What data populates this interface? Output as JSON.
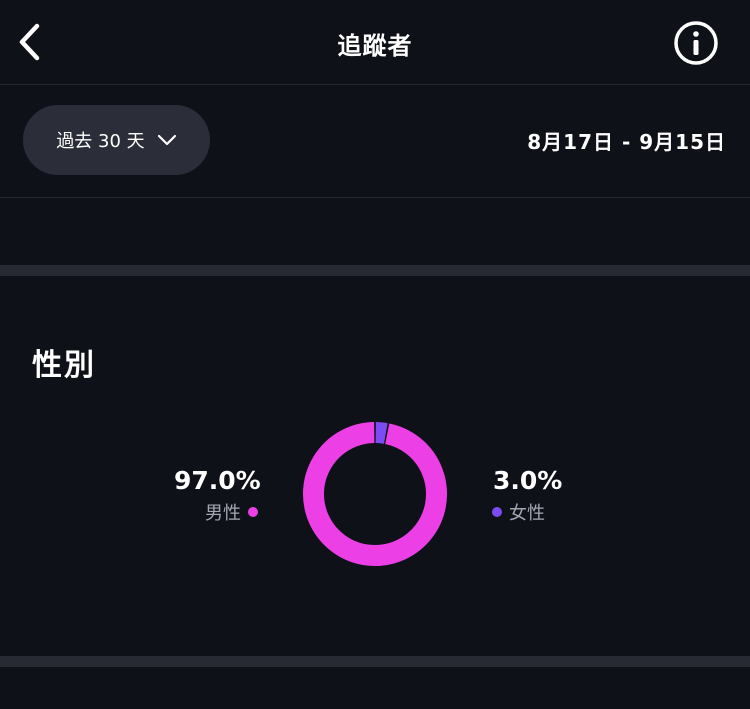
{
  "header": {
    "title": "追蹤者",
    "back_icon": "chevron-left-icon",
    "info_icon": "info-circle-icon"
  },
  "filter": {
    "period_label": "過去 30 天",
    "dropdown_icon": "chevron-down-icon",
    "date_range": "8月17日 - 9月15日"
  },
  "gender": {
    "title": "性別",
    "male": {
      "percent": "97.0%",
      "label": "男性",
      "color": "#ec40e6"
    },
    "female": {
      "percent": "3.0%",
      "label": "女性",
      "color": "#7b4cf2"
    }
  },
  "chart_data": {
    "type": "pie",
    "categories": [
      "男性",
      "女性"
    ],
    "values": [
      97.0,
      3.0
    ],
    "colors": [
      "#ec40e6",
      "#7b4cf2"
    ]
  },
  "colors": {
    "background": "#0f1119",
    "chip": "#2b2e38",
    "divider": "#272a33"
  }
}
